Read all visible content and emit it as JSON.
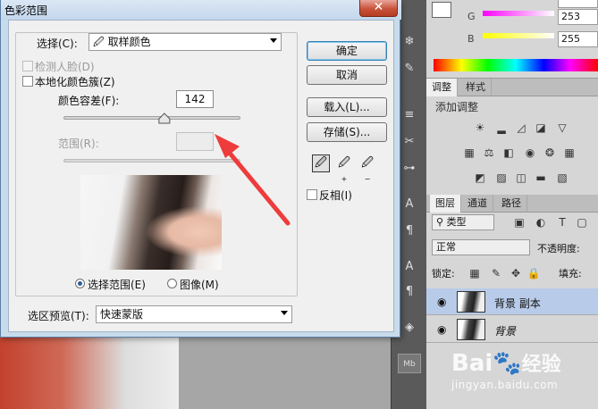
{
  "dialog": {
    "title": "色彩范围",
    "close_glyph": "✕",
    "select_label": "选择(C):",
    "select_value": "取样颜色",
    "detect_faces_label": "检测人脸(D)",
    "localized_label": "本地化颜色簇(Z)",
    "fuzziness_label": "颜色容差(F):",
    "fuzziness_value": "142",
    "fuzziness_level": 0.57,
    "range_label": "范围(R):",
    "range_value": "",
    "radio_selection": "选择范围(E)",
    "radio_image": "图像(M)",
    "preview_label": "选区预览(T):",
    "preview_value": "快速蒙版",
    "ok": "确定",
    "cancel": "取消",
    "load": "载入(L)...",
    "save": "存储(S)...",
    "invert_label": "反相(I)",
    "tools": [
      "eyedropper-icon",
      "eyedropper-plus-icon",
      "eyedropper-minus-icon"
    ]
  },
  "color_panel": {
    "g_label": "G",
    "b_label": "B",
    "r_value": "",
    "g_value": "253",
    "b_value": "255"
  },
  "adjustments": {
    "tabs": [
      "调整",
      "样式"
    ],
    "add_label": "添加调整"
  },
  "layers": {
    "tabs": [
      "图层",
      "通道",
      "路径"
    ],
    "filter": "类型",
    "blend_mode": "正常",
    "opacity_label": "不透明度:",
    "lock_label": "锁定:",
    "fill_label": "填充:",
    "rows": [
      {
        "name": "背景 副本"
      },
      {
        "name": "背景"
      }
    ]
  },
  "watermark": {
    "brand": "Bai",
    "brand_end": "经验",
    "url": "jingyan.baidu.com"
  },
  "colors": {
    "annotation_arrow": "#ee3b3b",
    "selected_layer": "#b8cbe8"
  }
}
